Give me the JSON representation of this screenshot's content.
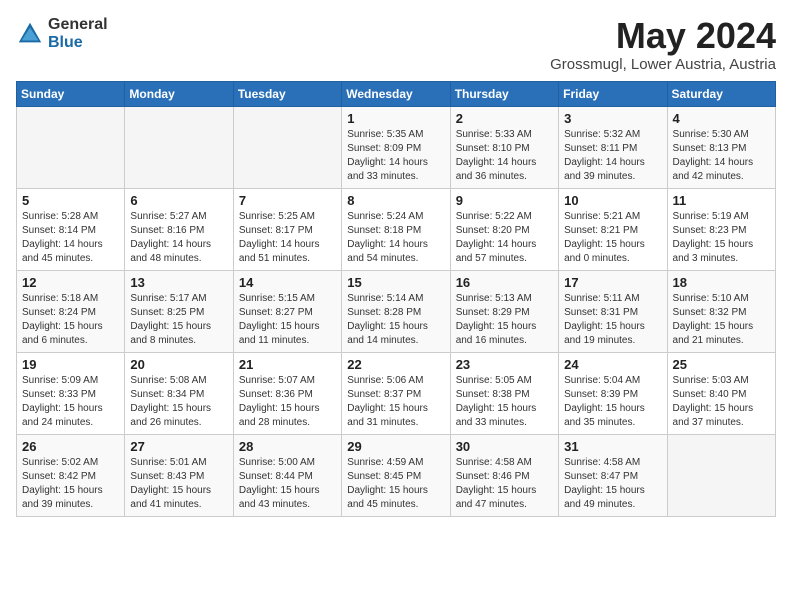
{
  "logo": {
    "general": "General",
    "blue": "Blue"
  },
  "title": "May 2024",
  "location": "Grossmugl, Lower Austria, Austria",
  "headers": [
    "Sunday",
    "Monday",
    "Tuesday",
    "Wednesday",
    "Thursday",
    "Friday",
    "Saturday"
  ],
  "weeks": [
    [
      {
        "day": "",
        "info": ""
      },
      {
        "day": "",
        "info": ""
      },
      {
        "day": "",
        "info": ""
      },
      {
        "day": "1",
        "info": "Sunrise: 5:35 AM\nSunset: 8:09 PM\nDaylight: 14 hours\nand 33 minutes."
      },
      {
        "day": "2",
        "info": "Sunrise: 5:33 AM\nSunset: 8:10 PM\nDaylight: 14 hours\nand 36 minutes."
      },
      {
        "day": "3",
        "info": "Sunrise: 5:32 AM\nSunset: 8:11 PM\nDaylight: 14 hours\nand 39 minutes."
      },
      {
        "day": "4",
        "info": "Sunrise: 5:30 AM\nSunset: 8:13 PM\nDaylight: 14 hours\nand 42 minutes."
      }
    ],
    [
      {
        "day": "5",
        "info": "Sunrise: 5:28 AM\nSunset: 8:14 PM\nDaylight: 14 hours\nand 45 minutes."
      },
      {
        "day": "6",
        "info": "Sunrise: 5:27 AM\nSunset: 8:16 PM\nDaylight: 14 hours\nand 48 minutes."
      },
      {
        "day": "7",
        "info": "Sunrise: 5:25 AM\nSunset: 8:17 PM\nDaylight: 14 hours\nand 51 minutes."
      },
      {
        "day": "8",
        "info": "Sunrise: 5:24 AM\nSunset: 8:18 PM\nDaylight: 14 hours\nand 54 minutes."
      },
      {
        "day": "9",
        "info": "Sunrise: 5:22 AM\nSunset: 8:20 PM\nDaylight: 14 hours\nand 57 minutes."
      },
      {
        "day": "10",
        "info": "Sunrise: 5:21 AM\nSunset: 8:21 PM\nDaylight: 15 hours\nand 0 minutes."
      },
      {
        "day": "11",
        "info": "Sunrise: 5:19 AM\nSunset: 8:23 PM\nDaylight: 15 hours\nand 3 minutes."
      }
    ],
    [
      {
        "day": "12",
        "info": "Sunrise: 5:18 AM\nSunset: 8:24 PM\nDaylight: 15 hours\nand 6 minutes."
      },
      {
        "day": "13",
        "info": "Sunrise: 5:17 AM\nSunset: 8:25 PM\nDaylight: 15 hours\nand 8 minutes."
      },
      {
        "day": "14",
        "info": "Sunrise: 5:15 AM\nSunset: 8:27 PM\nDaylight: 15 hours\nand 11 minutes."
      },
      {
        "day": "15",
        "info": "Sunrise: 5:14 AM\nSunset: 8:28 PM\nDaylight: 15 hours\nand 14 minutes."
      },
      {
        "day": "16",
        "info": "Sunrise: 5:13 AM\nSunset: 8:29 PM\nDaylight: 15 hours\nand 16 minutes."
      },
      {
        "day": "17",
        "info": "Sunrise: 5:11 AM\nSunset: 8:31 PM\nDaylight: 15 hours\nand 19 minutes."
      },
      {
        "day": "18",
        "info": "Sunrise: 5:10 AM\nSunset: 8:32 PM\nDaylight: 15 hours\nand 21 minutes."
      }
    ],
    [
      {
        "day": "19",
        "info": "Sunrise: 5:09 AM\nSunset: 8:33 PM\nDaylight: 15 hours\nand 24 minutes."
      },
      {
        "day": "20",
        "info": "Sunrise: 5:08 AM\nSunset: 8:34 PM\nDaylight: 15 hours\nand 26 minutes."
      },
      {
        "day": "21",
        "info": "Sunrise: 5:07 AM\nSunset: 8:36 PM\nDaylight: 15 hours\nand 28 minutes."
      },
      {
        "day": "22",
        "info": "Sunrise: 5:06 AM\nSunset: 8:37 PM\nDaylight: 15 hours\nand 31 minutes."
      },
      {
        "day": "23",
        "info": "Sunrise: 5:05 AM\nSunset: 8:38 PM\nDaylight: 15 hours\nand 33 minutes."
      },
      {
        "day": "24",
        "info": "Sunrise: 5:04 AM\nSunset: 8:39 PM\nDaylight: 15 hours\nand 35 minutes."
      },
      {
        "day": "25",
        "info": "Sunrise: 5:03 AM\nSunset: 8:40 PM\nDaylight: 15 hours\nand 37 minutes."
      }
    ],
    [
      {
        "day": "26",
        "info": "Sunrise: 5:02 AM\nSunset: 8:42 PM\nDaylight: 15 hours\nand 39 minutes."
      },
      {
        "day": "27",
        "info": "Sunrise: 5:01 AM\nSunset: 8:43 PM\nDaylight: 15 hours\nand 41 minutes."
      },
      {
        "day": "28",
        "info": "Sunrise: 5:00 AM\nSunset: 8:44 PM\nDaylight: 15 hours\nand 43 minutes."
      },
      {
        "day": "29",
        "info": "Sunrise: 4:59 AM\nSunset: 8:45 PM\nDaylight: 15 hours\nand 45 minutes."
      },
      {
        "day": "30",
        "info": "Sunrise: 4:58 AM\nSunset: 8:46 PM\nDaylight: 15 hours\nand 47 minutes."
      },
      {
        "day": "31",
        "info": "Sunrise: 4:58 AM\nSunset: 8:47 PM\nDaylight: 15 hours\nand 49 minutes."
      },
      {
        "day": "",
        "info": ""
      }
    ]
  ]
}
